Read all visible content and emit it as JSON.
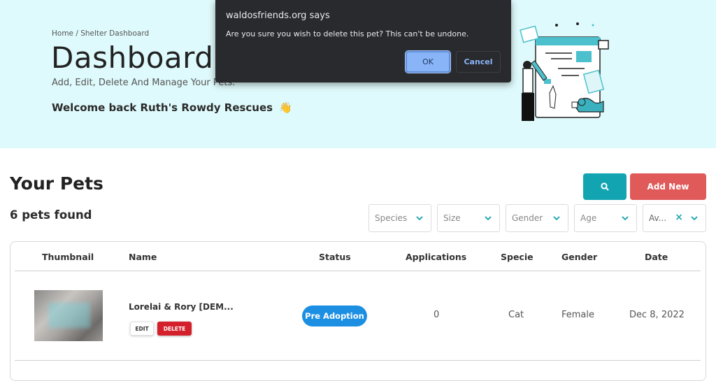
{
  "hero": {
    "breadcrumb": "Home / Shelter Dashboard",
    "title": "Dashboard",
    "subtitle": "Add, Edit, Delete And Manage Your Pets.",
    "welcome": "Welcome back Ruth's Rowdy Rescues",
    "welcome_emoji": "👋"
  },
  "dialog": {
    "origin": "waldosfriends.org says",
    "message": "Are you sure you wish to delete this pet? This can't be undone.",
    "ok_label": "OK",
    "cancel_label": "Cancel"
  },
  "pets_section": {
    "title": "Your Pets",
    "count_text": "6 pets found",
    "search_icon": "search-icon",
    "add_new_label": "Add New"
  },
  "filters": [
    {
      "placeholder": "Species"
    },
    {
      "placeholder": "Size"
    },
    {
      "placeholder": "Gender"
    },
    {
      "placeholder": "Age"
    },
    {
      "value": "Av...",
      "clearable": true
    }
  ],
  "table": {
    "columns": [
      "Thumbnail",
      "Name",
      "Status",
      "Applications",
      "Specie",
      "Gender",
      "Date"
    ],
    "rows": [
      {
        "name": "Lorelai & Rory [DEM...",
        "edit_label": "EDIT",
        "delete_label": "DELETE",
        "status": "Pre Adoption",
        "applications": "0",
        "specie": "Cat",
        "gender": "Female",
        "date": "Dec 8, 2022"
      }
    ]
  },
  "colors": {
    "hero_bg": "#dffafc",
    "teal": "#12a5b1",
    "add_new": "#e05a5a",
    "delete": "#d4202a",
    "status_blue": "#1c8fe3",
    "dialog_bg": "#292a2d",
    "dialog_ok": "#8ab4f8"
  }
}
